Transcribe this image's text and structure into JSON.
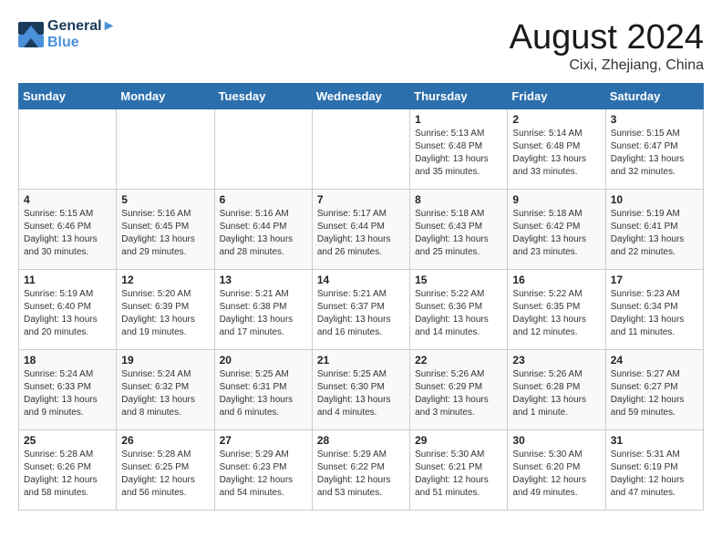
{
  "header": {
    "logo_line1": "General",
    "logo_line2": "Blue",
    "month": "August 2024",
    "location": "Cixi, Zhejiang, China"
  },
  "weekdays": [
    "Sunday",
    "Monday",
    "Tuesday",
    "Wednesday",
    "Thursday",
    "Friday",
    "Saturday"
  ],
  "weeks": [
    [
      {
        "day": "",
        "text": ""
      },
      {
        "day": "",
        "text": ""
      },
      {
        "day": "",
        "text": ""
      },
      {
        "day": "",
        "text": ""
      },
      {
        "day": "1",
        "text": "Sunrise: 5:13 AM\nSunset: 6:48 PM\nDaylight: 13 hours\nand 35 minutes."
      },
      {
        "day": "2",
        "text": "Sunrise: 5:14 AM\nSunset: 6:48 PM\nDaylight: 13 hours\nand 33 minutes."
      },
      {
        "day": "3",
        "text": "Sunrise: 5:15 AM\nSunset: 6:47 PM\nDaylight: 13 hours\nand 32 minutes."
      }
    ],
    [
      {
        "day": "4",
        "text": "Sunrise: 5:15 AM\nSunset: 6:46 PM\nDaylight: 13 hours\nand 30 minutes."
      },
      {
        "day": "5",
        "text": "Sunrise: 5:16 AM\nSunset: 6:45 PM\nDaylight: 13 hours\nand 29 minutes."
      },
      {
        "day": "6",
        "text": "Sunrise: 5:16 AM\nSunset: 6:44 PM\nDaylight: 13 hours\nand 28 minutes."
      },
      {
        "day": "7",
        "text": "Sunrise: 5:17 AM\nSunset: 6:44 PM\nDaylight: 13 hours\nand 26 minutes."
      },
      {
        "day": "8",
        "text": "Sunrise: 5:18 AM\nSunset: 6:43 PM\nDaylight: 13 hours\nand 25 minutes."
      },
      {
        "day": "9",
        "text": "Sunrise: 5:18 AM\nSunset: 6:42 PM\nDaylight: 13 hours\nand 23 minutes."
      },
      {
        "day": "10",
        "text": "Sunrise: 5:19 AM\nSunset: 6:41 PM\nDaylight: 13 hours\nand 22 minutes."
      }
    ],
    [
      {
        "day": "11",
        "text": "Sunrise: 5:19 AM\nSunset: 6:40 PM\nDaylight: 13 hours\nand 20 minutes."
      },
      {
        "day": "12",
        "text": "Sunrise: 5:20 AM\nSunset: 6:39 PM\nDaylight: 13 hours\nand 19 minutes."
      },
      {
        "day": "13",
        "text": "Sunrise: 5:21 AM\nSunset: 6:38 PM\nDaylight: 13 hours\nand 17 minutes."
      },
      {
        "day": "14",
        "text": "Sunrise: 5:21 AM\nSunset: 6:37 PM\nDaylight: 13 hours\nand 16 minutes."
      },
      {
        "day": "15",
        "text": "Sunrise: 5:22 AM\nSunset: 6:36 PM\nDaylight: 13 hours\nand 14 minutes."
      },
      {
        "day": "16",
        "text": "Sunrise: 5:22 AM\nSunset: 6:35 PM\nDaylight: 13 hours\nand 12 minutes."
      },
      {
        "day": "17",
        "text": "Sunrise: 5:23 AM\nSunset: 6:34 PM\nDaylight: 13 hours\nand 11 minutes."
      }
    ],
    [
      {
        "day": "18",
        "text": "Sunrise: 5:24 AM\nSunset: 6:33 PM\nDaylight: 13 hours\nand 9 minutes."
      },
      {
        "day": "19",
        "text": "Sunrise: 5:24 AM\nSunset: 6:32 PM\nDaylight: 13 hours\nand 8 minutes."
      },
      {
        "day": "20",
        "text": "Sunrise: 5:25 AM\nSunset: 6:31 PM\nDaylight: 13 hours\nand 6 minutes."
      },
      {
        "day": "21",
        "text": "Sunrise: 5:25 AM\nSunset: 6:30 PM\nDaylight: 13 hours\nand 4 minutes."
      },
      {
        "day": "22",
        "text": "Sunrise: 5:26 AM\nSunset: 6:29 PM\nDaylight: 13 hours\nand 3 minutes."
      },
      {
        "day": "23",
        "text": "Sunrise: 5:26 AM\nSunset: 6:28 PM\nDaylight: 13 hours\nand 1 minute."
      },
      {
        "day": "24",
        "text": "Sunrise: 5:27 AM\nSunset: 6:27 PM\nDaylight: 12 hours\nand 59 minutes."
      }
    ],
    [
      {
        "day": "25",
        "text": "Sunrise: 5:28 AM\nSunset: 6:26 PM\nDaylight: 12 hours\nand 58 minutes."
      },
      {
        "day": "26",
        "text": "Sunrise: 5:28 AM\nSunset: 6:25 PM\nDaylight: 12 hours\nand 56 minutes."
      },
      {
        "day": "27",
        "text": "Sunrise: 5:29 AM\nSunset: 6:23 PM\nDaylight: 12 hours\nand 54 minutes."
      },
      {
        "day": "28",
        "text": "Sunrise: 5:29 AM\nSunset: 6:22 PM\nDaylight: 12 hours\nand 53 minutes."
      },
      {
        "day": "29",
        "text": "Sunrise: 5:30 AM\nSunset: 6:21 PM\nDaylight: 12 hours\nand 51 minutes."
      },
      {
        "day": "30",
        "text": "Sunrise: 5:30 AM\nSunset: 6:20 PM\nDaylight: 12 hours\nand 49 minutes."
      },
      {
        "day": "31",
        "text": "Sunrise: 5:31 AM\nSunset: 6:19 PM\nDaylight: 12 hours\nand 47 minutes."
      }
    ]
  ]
}
